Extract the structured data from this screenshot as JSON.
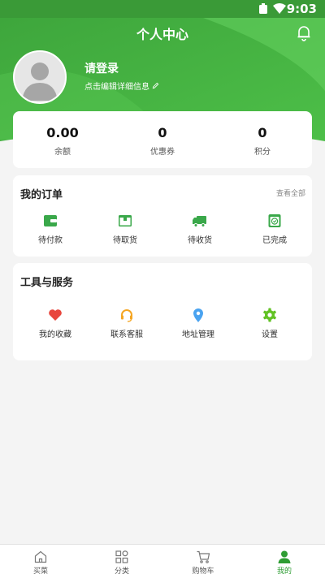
{
  "status_bar": {
    "time": "9:03"
  },
  "header": {
    "title": "个人中心"
  },
  "profile": {
    "login_text": "请登录",
    "edit_hint": "点击编辑详细信息"
  },
  "stats": [
    {
      "value": "0.00",
      "label": "余额"
    },
    {
      "value": "0",
      "label": "优惠券"
    },
    {
      "value": "0",
      "label": "积分"
    }
  ],
  "orders": {
    "title": "我的订单",
    "view_all": "查看全部",
    "items": [
      {
        "label": "待付款",
        "icon": "wallet-icon"
      },
      {
        "label": "待取货",
        "icon": "package-icon"
      },
      {
        "label": "待收货",
        "icon": "truck-icon"
      },
      {
        "label": "已完成",
        "icon": "check-box-icon"
      }
    ]
  },
  "services": {
    "title": "工具与服务",
    "items": [
      {
        "label": "我的收藏",
        "icon": "heart-icon"
      },
      {
        "label": "联系客服",
        "icon": "headset-icon"
      },
      {
        "label": "地址管理",
        "icon": "location-pin-icon"
      },
      {
        "label": "设置",
        "icon": "gear-icon"
      }
    ]
  },
  "tabbar": {
    "items": [
      {
        "label": "买菜",
        "icon": "home-icon"
      },
      {
        "label": "分类",
        "icon": "category-icon"
      },
      {
        "label": "购物车",
        "icon": "cart-icon"
      },
      {
        "label": "我的",
        "icon": "user-icon"
      }
    ],
    "active_index": 3
  },
  "colors": {
    "primary": "#3cb54a",
    "header_dark": "#3a9a37",
    "header_light": "#5fd05a",
    "heart": "#e8453c",
    "headset": "#f5a623",
    "pin": "#4aa3f0",
    "gear": "#62c224",
    "order_icon": "#3aa84a"
  }
}
